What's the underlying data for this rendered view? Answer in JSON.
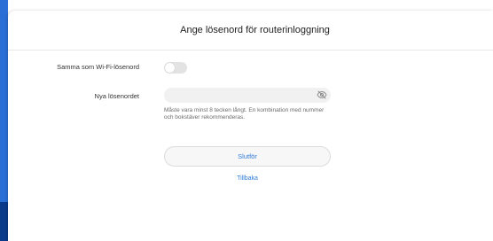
{
  "header": {
    "title": "Ange lösenord för routerinloggning"
  },
  "form": {
    "same_as_wifi_label": "Samma som Wi-Fi-lösenord",
    "same_as_wifi_on": false,
    "new_password_label": "Nya lösenordet",
    "new_password_value": "",
    "new_password_hint": "Måste vara minst 8 tecken långt. En kombination med nummer och bokstäver rekommenderas."
  },
  "actions": {
    "finish_label": "Slutför",
    "back_label": "Tillbaka"
  },
  "icons": {
    "password_visibility": "eye-off-icon"
  },
  "colors": {
    "accent": "#2f7bd8",
    "toggle_off": "#e3e3e3",
    "field_bg": "#f1f1f1",
    "desktop_edge": "#2a6fd6"
  }
}
